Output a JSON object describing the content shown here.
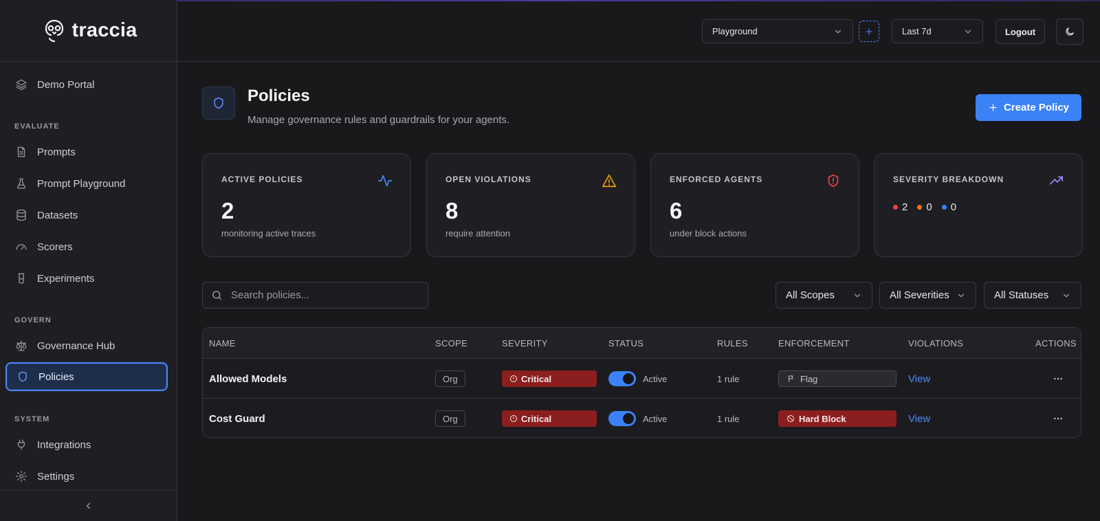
{
  "app": {
    "name": "traccia"
  },
  "sidebar": {
    "top_item": {
      "label": "Demo Portal",
      "icon": "layers-icon"
    },
    "sections": [
      {
        "title": "EVALUATE",
        "items": [
          {
            "label": "Prompts",
            "icon": "document-icon"
          },
          {
            "label": "Prompt Playground",
            "icon": "flask-icon"
          },
          {
            "label": "Datasets",
            "icon": "database-icon"
          },
          {
            "label": "Scorers",
            "icon": "gauge-icon"
          },
          {
            "label": "Experiments",
            "icon": "beaker-icon"
          }
        ]
      },
      {
        "title": "GOVERN",
        "items": [
          {
            "label": "Governance Hub",
            "icon": "scale-icon"
          },
          {
            "label": "Policies",
            "icon": "shield-icon",
            "active": true
          }
        ]
      },
      {
        "title": "SYSTEM",
        "items": [
          {
            "label": "Integrations",
            "icon": "plug-icon"
          },
          {
            "label": "Settings",
            "icon": "gear-icon"
          }
        ]
      }
    ]
  },
  "header": {
    "project": "Playground",
    "range": "Last 7d",
    "logout": "Logout"
  },
  "page": {
    "title": "Policies",
    "subtitle": "Manage governance rules and guardrails for your agents.",
    "create_button": "Create Policy"
  },
  "stats": [
    {
      "label": "ACTIVE POLICIES",
      "value": "2",
      "sub": "monitoring active traces",
      "icon": "activity-icon",
      "color": "#4b86ff"
    },
    {
      "label": "OPEN VIOLATIONS",
      "value": "8",
      "sub": "require attention",
      "icon": "warning-icon",
      "color": "#f59e0b"
    },
    {
      "label": "ENFORCED AGENTS",
      "value": "6",
      "sub": "under block actions",
      "icon": "shield-alert-icon",
      "color": "#ef4444"
    },
    {
      "label": "SEVERITY BREAKDOWN",
      "icon": "trending-up-icon",
      "color": "#a78bfa",
      "breakdown": [
        {
          "count": "2",
          "color": "#ef4444"
        },
        {
          "count": "0",
          "color": "#f97316"
        },
        {
          "count": "0",
          "color": "#3b82f6"
        }
      ]
    }
  ],
  "filters": {
    "search_placeholder": "Search policies...",
    "scope": "All Scopes",
    "severity": "All Severities",
    "status": "All Statuses"
  },
  "table": {
    "columns": [
      "NAME",
      "SCOPE",
      "SEVERITY",
      "STATUS",
      "RULES",
      "ENFORCEMENT",
      "VIOLATIONS",
      "ACTIONS"
    ],
    "rows": [
      {
        "name": "Allowed Models",
        "scope": "Org",
        "severity": "Critical",
        "status": "Active",
        "rules": "1 rule",
        "enforcement": "Flag",
        "violations": "View"
      },
      {
        "name": "Cost Guard",
        "scope": "Org",
        "severity": "Critical",
        "status": "Active",
        "rules": "1 rule",
        "enforcement": "Hard Block",
        "violations": "View"
      }
    ]
  }
}
